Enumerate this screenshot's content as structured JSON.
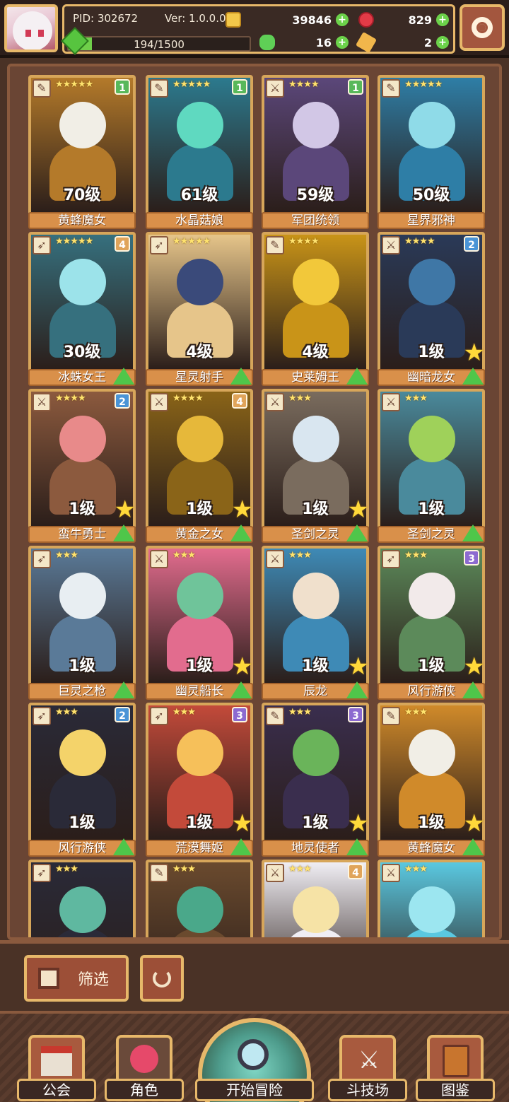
{
  "header": {
    "pid": "PID: 302672",
    "version": "Ver: 1.0.0.0",
    "xp_text": "194/1500",
    "xp_progress": 0.1293,
    "gold": "39846",
    "gems": "829",
    "clover": "16",
    "keys": "2"
  },
  "colors": {
    "accent_gold": "#e7b86a",
    "frame_brown": "#8a5a3e",
    "name_banner": "#d9904a",
    "upgrade_green": "#4fc64a",
    "star_yellow": "#ffd93a"
  },
  "cards": [
    {
      "name": "黄蜂魔女",
      "level": "70级",
      "stars": "★★★★★",
      "badge": "1",
      "badge_color": "#58b85a",
      "weapon": "wand",
      "can_upgrade": false,
      "star_corner": false,
      "palette": [
        "#f1eee6",
        "#b47a2a"
      ]
    },
    {
      "name": "水晶菇娘",
      "level": "61级",
      "stars": "★★★★★",
      "badge": "1",
      "badge_color": "#58b85a",
      "weapon": "wand",
      "can_upgrade": false,
      "star_corner": false,
      "palette": [
        "#5fd9c0",
        "#2c7a8e"
      ]
    },
    {
      "name": "军团统领",
      "level": "59级",
      "stars": "★★★★",
      "badge": "1",
      "badge_color": "#58b85a",
      "weapon": "sword",
      "can_upgrade": false,
      "star_corner": false,
      "palette": [
        "#d2c7e6",
        "#5b477a"
      ]
    },
    {
      "name": "星界邪神",
      "level": "50级",
      "stars": "★★★★★",
      "badge": "",
      "badge_color": "#5ab7e0",
      "weapon": "wand",
      "can_upgrade": false,
      "star_corner": false,
      "palette": [
        "#8fdbe8",
        "#2e7ea6"
      ]
    },
    {
      "name": "冰蛛女王",
      "level": "30级",
      "stars": "★★★★★",
      "badge": "4",
      "badge_color": "#e0a45a",
      "weapon": "bow",
      "can_upgrade": true,
      "star_corner": false,
      "palette": [
        "#9ce3ea",
        "#36707e"
      ]
    },
    {
      "name": "星灵射手",
      "level": "4级",
      "stars": "★★★★★",
      "badge": "",
      "badge_color": "#e0a45a",
      "weapon": "bow",
      "can_upgrade": true,
      "star_corner": false,
      "palette": [
        "#3a4a7a",
        "#e6c58a"
      ]
    },
    {
      "name": "史莱姆王",
      "level": "4级",
      "stars": "★★★★",
      "badge": "",
      "badge_color": "#e0a45a",
      "weapon": "wand",
      "can_upgrade": true,
      "star_corner": false,
      "palette": [
        "#f2c83a",
        "#c99418"
      ]
    },
    {
      "name": "幽暗龙女",
      "level": "1级",
      "stars": "★★★★",
      "badge": "2",
      "badge_color": "#4a94d6",
      "weapon": "sword",
      "can_upgrade": true,
      "star_corner": true,
      "palette": [
        "#3f77a6",
        "#2a3a58"
      ]
    },
    {
      "name": "蛮牛勇士",
      "level": "1级",
      "stars": "★★★★",
      "badge": "2",
      "badge_color": "#4a94d6",
      "weapon": "sword",
      "can_upgrade": true,
      "star_corner": true,
      "palette": [
        "#e88a8a",
        "#8c5a3e"
      ]
    },
    {
      "name": "黄金之女",
      "level": "1级",
      "stars": "★★★★",
      "badge": "4",
      "badge_color": "#e0a45a",
      "weapon": "sword",
      "can_upgrade": true,
      "star_corner": true,
      "palette": [
        "#e6b83a",
        "#8a6418"
      ]
    },
    {
      "name": "圣剑之灵",
      "level": "1级",
      "stars": "★★★",
      "badge": "",
      "badge_color": "#e0a45a",
      "weapon": "sword",
      "can_upgrade": true,
      "star_corner": true,
      "palette": [
        "#d9e6f0",
        "#7a6c5e"
      ]
    },
    {
      "name": "圣剑之灵",
      "level": "1级",
      "stars": "★★★",
      "badge": "",
      "badge_color": "#e0a45a",
      "weapon": "sword",
      "can_upgrade": true,
      "star_corner": false,
      "palette": [
        "#9fd15a",
        "#4a8a9c"
      ]
    },
    {
      "name": "巨灵之枪",
      "level": "1级",
      "stars": "★★★",
      "badge": "",
      "badge_color": "#e0a45a",
      "weapon": "bow",
      "can_upgrade": true,
      "star_corner": false,
      "palette": [
        "#e8eef2",
        "#5a7a98"
      ]
    },
    {
      "name": "幽灵船长",
      "level": "1级",
      "stars": "★★★",
      "badge": "",
      "badge_color": "#e0a45a",
      "weapon": "sword",
      "can_upgrade": true,
      "star_corner": true,
      "palette": [
        "#6fc49a",
        "#e26c8e"
      ]
    },
    {
      "name": "辰龙",
      "level": "1级",
      "stars": "★★★",
      "badge": "",
      "badge_color": "#e0a45a",
      "weapon": "sword",
      "can_upgrade": true,
      "star_corner": true,
      "palette": [
        "#f0e0cc",
        "#3e8ab6"
      ]
    },
    {
      "name": "风行游侠",
      "level": "1级",
      "stars": "★★★",
      "badge": "3",
      "badge_color": "#8c6ad0",
      "weapon": "bow",
      "can_upgrade": true,
      "star_corner": true,
      "palette": [
        "#f2eaea",
        "#5c8a5a"
      ]
    },
    {
      "name": "风行游侠",
      "level": "1级",
      "stars": "★★★",
      "badge": "2",
      "badge_color": "#4a94d6",
      "weapon": "bow",
      "can_upgrade": true,
      "star_corner": false,
      "palette": [
        "#f4d36a",
        "#2a2a38"
      ]
    },
    {
      "name": "荒漠舞姬",
      "level": "1级",
      "stars": "★★★",
      "badge": "3",
      "badge_color": "#8c6ad0",
      "weapon": "bow",
      "can_upgrade": true,
      "star_corner": true,
      "palette": [
        "#f6c05a",
        "#c34a3a"
      ]
    },
    {
      "name": "地灵使者",
      "level": "1级",
      "stars": "★★★",
      "badge": "3",
      "badge_color": "#8c6ad0",
      "weapon": "wand",
      "can_upgrade": true,
      "star_corner": true,
      "palette": [
        "#6ab45a",
        "#3a2e4e"
      ]
    },
    {
      "name": "黄蜂魔女",
      "level": "1级",
      "stars": "★★★",
      "badge": "",
      "badge_color": "#e0a45a",
      "weapon": "wand",
      "can_upgrade": true,
      "star_corner": true,
      "palette": [
        "#f1eee6",
        "#d08a2a"
      ]
    },
    {
      "name": "",
      "level": "",
      "stars": "★★★",
      "badge": "",
      "badge_color": "#e0a45a",
      "weapon": "bow",
      "can_upgrade": false,
      "star_corner": false,
      "palette": [
        "#5fb8a0",
        "#2a2a38"
      ]
    },
    {
      "name": "",
      "level": "",
      "stars": "★★★",
      "badge": "",
      "badge_color": "#8c4ad0",
      "weapon": "wand",
      "can_upgrade": false,
      "star_corner": false,
      "palette": [
        "#4aa88a",
        "#6a4a2e"
      ]
    },
    {
      "name": "",
      "level": "",
      "stars": "★★★",
      "badge": "4",
      "badge_color": "#e0a45a",
      "weapon": "sword",
      "can_upgrade": false,
      "star_corner": false,
      "palette": [
        "#f6e3a6",
        "#f0eef4"
      ]
    },
    {
      "name": "",
      "level": "",
      "stars": "★★★",
      "badge": "",
      "badge_color": "#e0a45a",
      "weapon": "sword",
      "can_upgrade": false,
      "star_corner": false,
      "palette": [
        "#9ce6f0",
        "#5ac8e0"
      ]
    }
  ],
  "toolbar": {
    "filter_label": "筛选"
  },
  "nav": {
    "guild": "公会",
    "character": "角色",
    "adventure": "开始冒险",
    "arena": "斗技场",
    "codex": "图鉴"
  }
}
